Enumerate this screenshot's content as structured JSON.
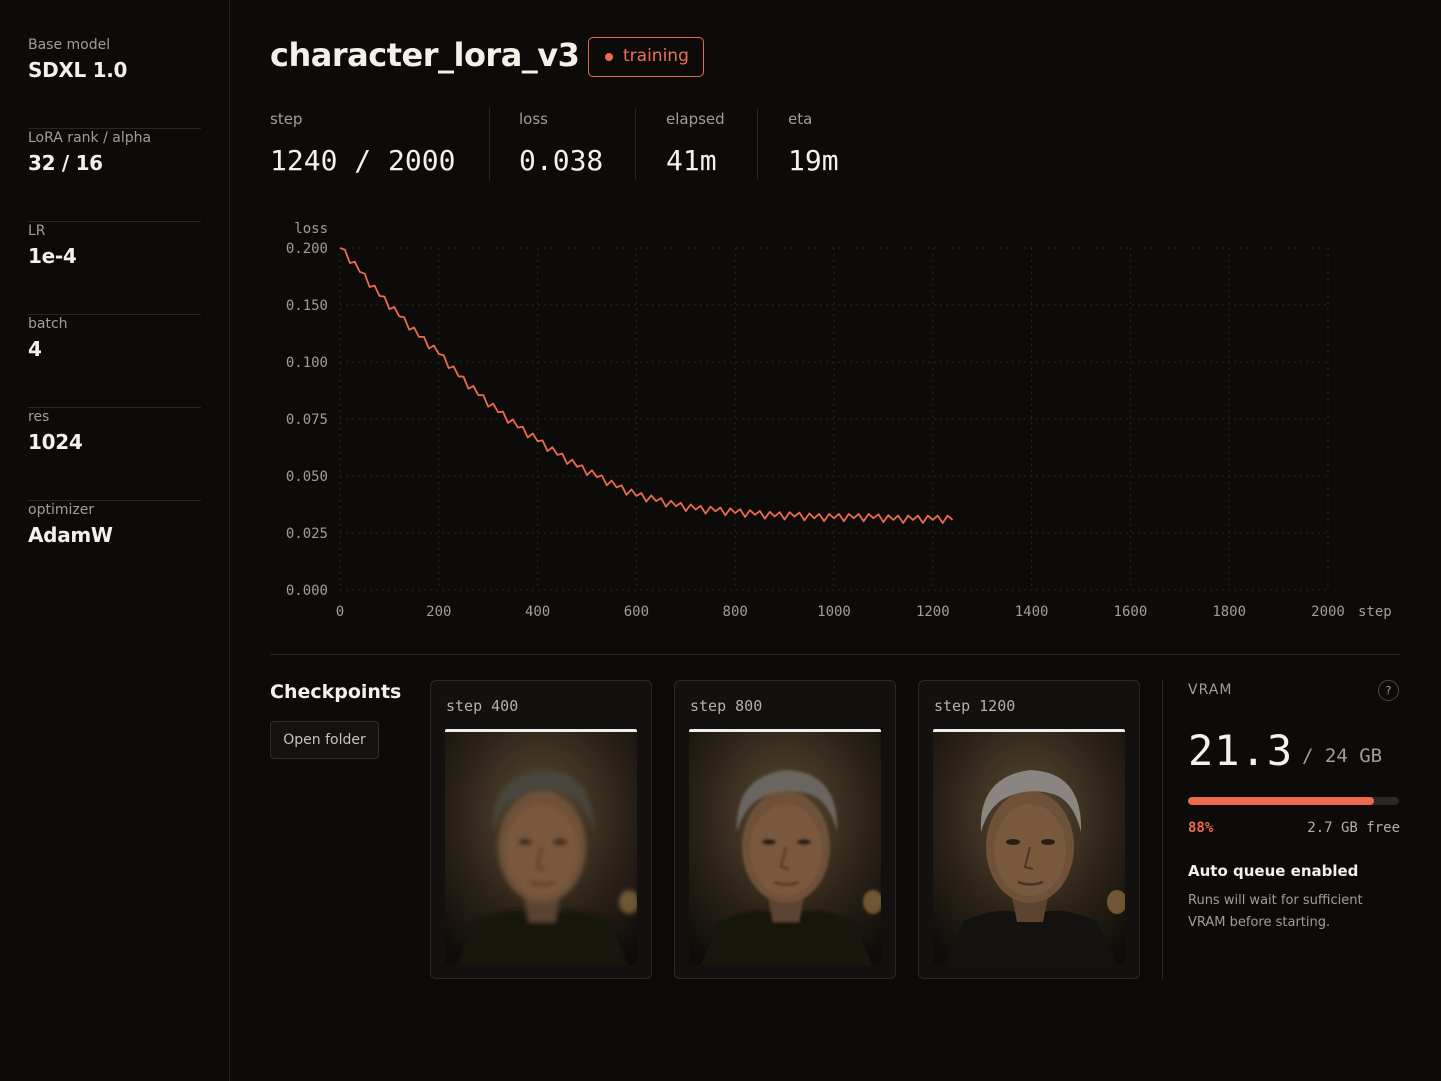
{
  "sidebar": {
    "items": [
      {
        "label": "Base model",
        "value": "SDXL 1.0"
      },
      {
        "label": "LoRA rank / alpha",
        "value": "32 / 16"
      },
      {
        "label": "LR",
        "value": "1e-4"
      },
      {
        "label": "batch",
        "value": "4"
      },
      {
        "label": "res",
        "value": "1024"
      },
      {
        "label": "optimizer",
        "value": "AdamW"
      }
    ]
  },
  "header": {
    "title": "character_lora_v3",
    "status": "training",
    "status_color": "#ec6a4e"
  },
  "stats": [
    {
      "label": "step",
      "value": "1240 / 2000"
    },
    {
      "label": "loss",
      "value": "0.038"
    },
    {
      "label": "elapsed",
      "value": "41m"
    },
    {
      "label": "eta",
      "value": "19m"
    }
  ],
  "chart_data": {
    "type": "line",
    "title": "",
    "xlabel": "step",
    "ylabel": "loss",
    "xlim": [
      0,
      2000
    ],
    "ylim": [
      0,
      0.2
    ],
    "x_ticks": [
      0,
      200,
      400,
      600,
      800,
      1000,
      1200,
      1400,
      1600,
      1800,
      2000
    ],
    "y_ticks": [
      "0.000",
      "0.025",
      "0.050",
      "0.075",
      "0.100",
      "0.150",
      "0.200"
    ],
    "grid": true,
    "series": [
      {
        "color": "#ec6a4e",
        "x": [
          0,
          40,
          80,
          120,
          160,
          200,
          240,
          280,
          320,
          360,
          400,
          440,
          480,
          520,
          560,
          600,
          640,
          680,
          720,
          760,
          800,
          840,
          880,
          920,
          960,
          1000,
          1040,
          1080,
          1120,
          1160,
          1200,
          1240
        ],
        "y": [
          0.2,
          0.186,
          0.172,
          0.16,
          0.148,
          0.138,
          0.125,
          0.114,
          0.104,
          0.095,
          0.087,
          0.079,
          0.072,
          0.066,
          0.06,
          0.055,
          0.052,
          0.049,
          0.047,
          0.046,
          0.045,
          0.044,
          0.043,
          0.043,
          0.042,
          0.042,
          0.042,
          0.042,
          0.041,
          0.041,
          0.041,
          0.041
        ]
      }
    ]
  },
  "checkpoints": {
    "title": "Checkpoints",
    "open_folder": "Open folder",
    "items": [
      {
        "label": "step 400",
        "sharpness": 0.35
      },
      {
        "label": "step 800",
        "sharpness": 0.65
      },
      {
        "label": "step 1200",
        "sharpness": 1.0
      }
    ]
  },
  "vram": {
    "label": "VRAM",
    "help": "?",
    "used": "21.3",
    "total": "/ 24 GB",
    "fill": 0.88,
    "percent": "88%",
    "free": "2.7 GB free",
    "queue_title": "Auto queue enabled",
    "queue_text": "Runs will wait for sufficient VRAM before starting."
  }
}
